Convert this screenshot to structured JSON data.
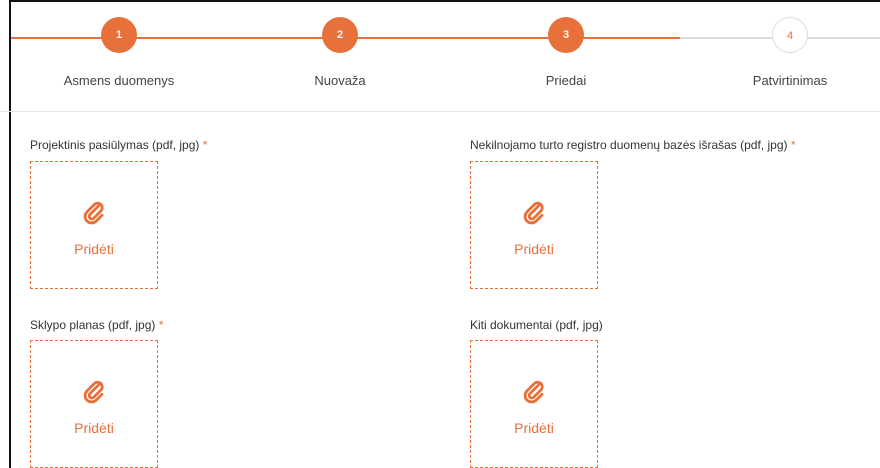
{
  "colors": {
    "accent": "#e8703a",
    "inactive": "#dcdcdc"
  },
  "steps": [
    {
      "number": "1",
      "label": "Asmens duomenys",
      "state": "done"
    },
    {
      "number": "2",
      "label": "Nuovaža",
      "state": "done"
    },
    {
      "number": "3",
      "label": "Priedai",
      "state": "done"
    },
    {
      "number": "4",
      "label": "Patvirtinimas",
      "state": "todo"
    }
  ],
  "uploads": [
    {
      "label": "Projektinis pasiūlymas (pdf, jpg)",
      "required_mark": "*",
      "button": "Pridėti",
      "icon": "paperclip-icon"
    },
    {
      "label": "Nekilnojamo turto registro duomenų bazės išrašas (pdf, jpg)",
      "required_mark": "*",
      "button": "Pridėti",
      "icon": "paperclip-icon"
    },
    {
      "label": "Sklypo planas (pdf, jpg)",
      "required_mark": "*",
      "button": "Pridėti",
      "icon": "paperclip-icon"
    },
    {
      "label": "Kiti dokumentai (pdf, jpg)",
      "required_mark": "",
      "button": "Pridėti",
      "icon": "paperclip-icon"
    }
  ]
}
